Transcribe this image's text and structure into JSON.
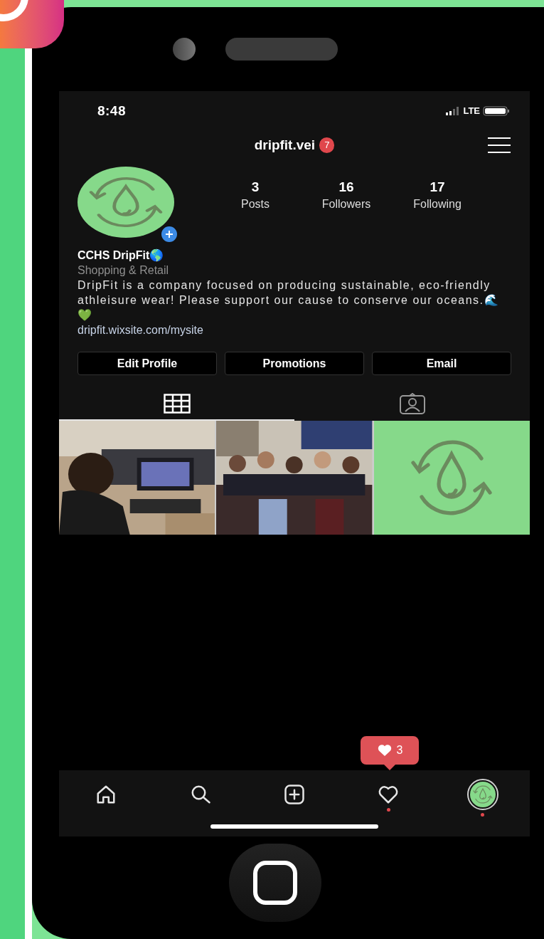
{
  "status_bar": {
    "time": "8:48",
    "network": "LTE"
  },
  "header": {
    "username": "dripfit.vei",
    "notification_count": "7"
  },
  "profile": {
    "stats": [
      {
        "value": "3",
        "label": "Posts"
      },
      {
        "value": "16",
        "label": "Followers"
      },
      {
        "value": "17",
        "label": "Following"
      }
    ],
    "name": "CCHS DripFit🌎",
    "category": "Shopping & Retail",
    "bio": "DripFit is a company focused on producing sustainable, eco-friendly athleisure wear! Please support our cause to conserve our oceans.🌊💚",
    "link": "dripfit.wixsite.com/mysite"
  },
  "buttons": [
    "Edit Profile",
    "Promotions",
    "Email"
  ],
  "tabs": [
    {
      "kind": "grid",
      "selected": true
    },
    {
      "kind": "tagged",
      "selected": false
    }
  ],
  "posts": [
    {
      "kind": "picture"
    },
    {
      "kind": "group"
    },
    {
      "kind": "logo"
    }
  ],
  "activity_popup": {
    "count": "3"
  },
  "nav": [
    {
      "kind": "home"
    },
    {
      "kind": "search"
    },
    {
      "kind": "add"
    },
    {
      "kind": "activity",
      "dot": true
    },
    {
      "kind": "profile",
      "dot": true
    }
  ]
}
